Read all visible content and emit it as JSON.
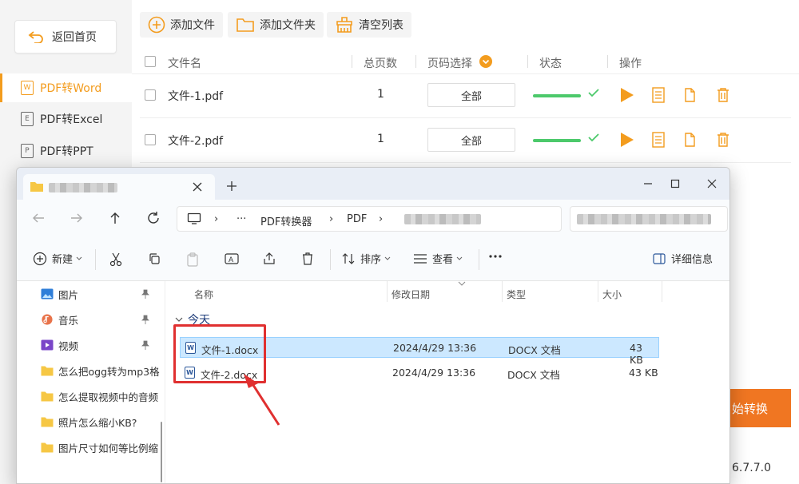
{
  "app": {
    "back_label": "返回首页",
    "sidebar": [
      {
        "label": "PDF转Word",
        "icon": "W",
        "active": true
      },
      {
        "label": "PDF转Excel",
        "icon": "E",
        "active": false
      },
      {
        "label": "PDF转PPT",
        "icon": "P",
        "active": false
      }
    ],
    "toolbar": {
      "add_file": "添加文件",
      "add_folder": "添加文件夹",
      "clear_list": "清空列表"
    },
    "columns": {
      "name": "文件名",
      "pages": "总页数",
      "page_select": "页码选择",
      "status": "状态",
      "actions": "操作"
    },
    "rows": [
      {
        "name": "文件-1.pdf",
        "pages": "1",
        "page_select": "全部",
        "progress": 1.0
      },
      {
        "name": "文件-2.pdf",
        "pages": "1",
        "page_select": "全部",
        "progress": 1.0
      }
    ],
    "convert_label": "始转换",
    "version": "6.7.7.0",
    "accent_color": "#f39c1e",
    "status_color": "#4cc96b"
  },
  "explorer": {
    "new_label": "新建",
    "sort_label": "排序",
    "view_label": "查看",
    "details_label": "详细信息",
    "breadcrumb": [
      "PDF转换器",
      "PDF"
    ],
    "breadcrumb_more": "···",
    "nav_items": [
      {
        "label": "图片",
        "icon": "picture-icon",
        "pinned": true
      },
      {
        "label": "音乐",
        "icon": "music-icon",
        "pinned": true
      },
      {
        "label": "视频",
        "icon": "video-icon",
        "pinned": true
      },
      {
        "label": "怎么把ogg转为mp3格",
        "icon": "folder-icon",
        "pinned": false
      },
      {
        "label": "怎么提取视频中的音频",
        "icon": "folder-icon",
        "pinned": false
      },
      {
        "label": "照片怎么缩小KB?",
        "icon": "folder-icon",
        "pinned": false
      },
      {
        "label": "图片尺寸如何等比例缩",
        "icon": "folder-icon",
        "pinned": false
      }
    ],
    "columns": {
      "name": "名称",
      "modified": "修改日期",
      "type": "类型",
      "size": "大小"
    },
    "group_label": "今天",
    "files": [
      {
        "name": "文件-1.docx",
        "modified": "2024/4/29 13:36",
        "type": "DOCX 文档",
        "size": "43 KB",
        "selected": true
      },
      {
        "name": "文件-2.docx",
        "modified": "2024/4/29 13:36",
        "type": "DOCX 文档",
        "size": "43 KB",
        "selected": false
      }
    ],
    "highlight_color": "#e03030"
  }
}
